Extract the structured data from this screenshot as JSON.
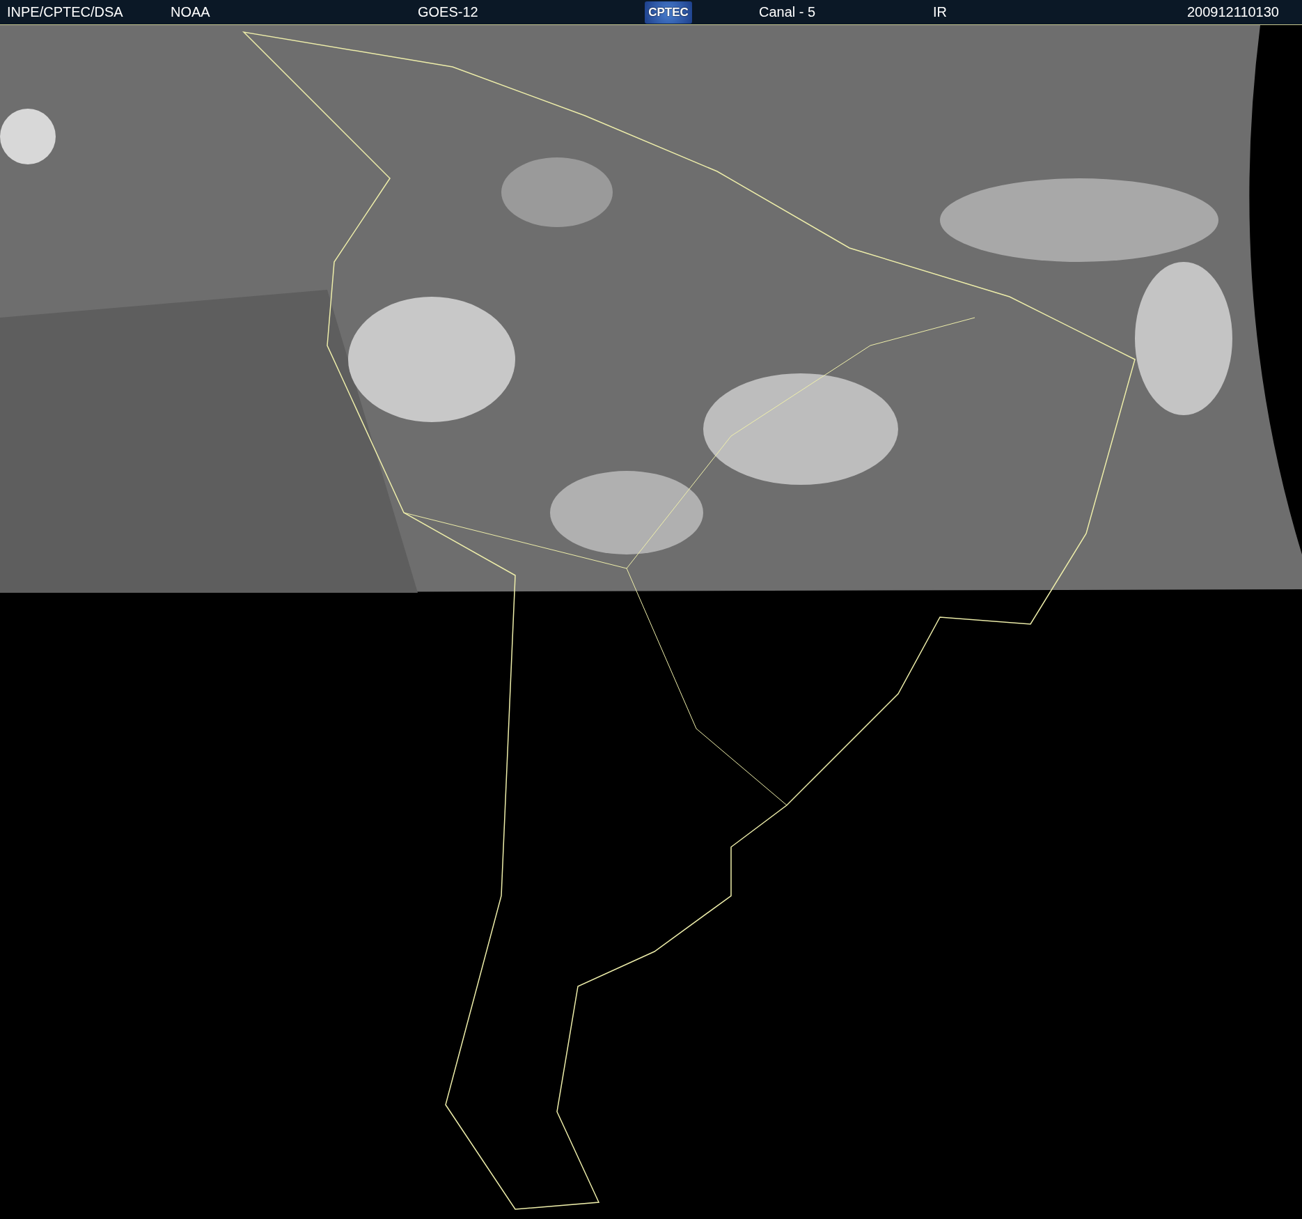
{
  "header": {
    "agency": "INPE/CPTEC/DSA",
    "source": "NOAA",
    "satellite": "GOES-12",
    "logo": "CPTEC",
    "channel": "Canal - 5",
    "band": "IR",
    "timestamp": "200912110130"
  }
}
